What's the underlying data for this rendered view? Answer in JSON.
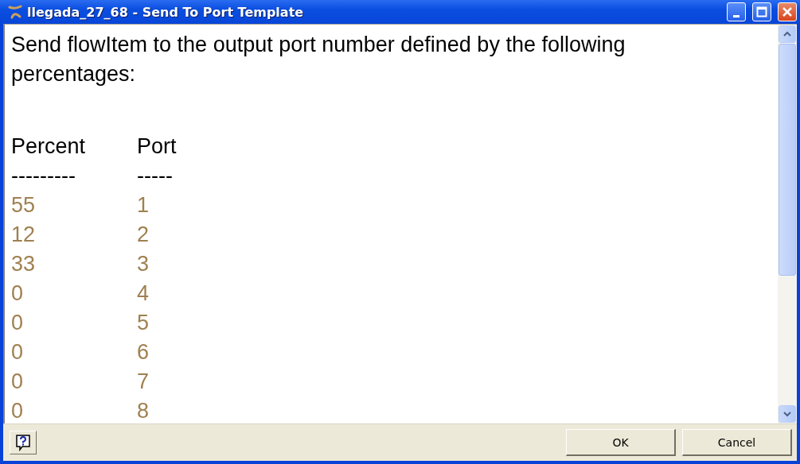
{
  "window": {
    "title": "llegada_27_68 - Send To Port Template"
  },
  "description": "Send flowItem to the output port number defined by the following percentages:",
  "columns": [
    "Percent",
    "Port"
  ],
  "separators": [
    "---------",
    "-----"
  ],
  "rows": [
    {
      "percent": "55",
      "port": "1"
    },
    {
      "percent": "12",
      "port": "2"
    },
    {
      "percent": "33",
      "port": "3"
    },
    {
      "percent": "0",
      "port": "4"
    },
    {
      "percent": "0",
      "port": "5"
    },
    {
      "percent": "0",
      "port": "6"
    },
    {
      "percent": "0",
      "port": "7"
    },
    {
      "percent": "0",
      "port": "8"
    }
  ],
  "buttons": [
    "OK",
    "Cancel"
  ]
}
